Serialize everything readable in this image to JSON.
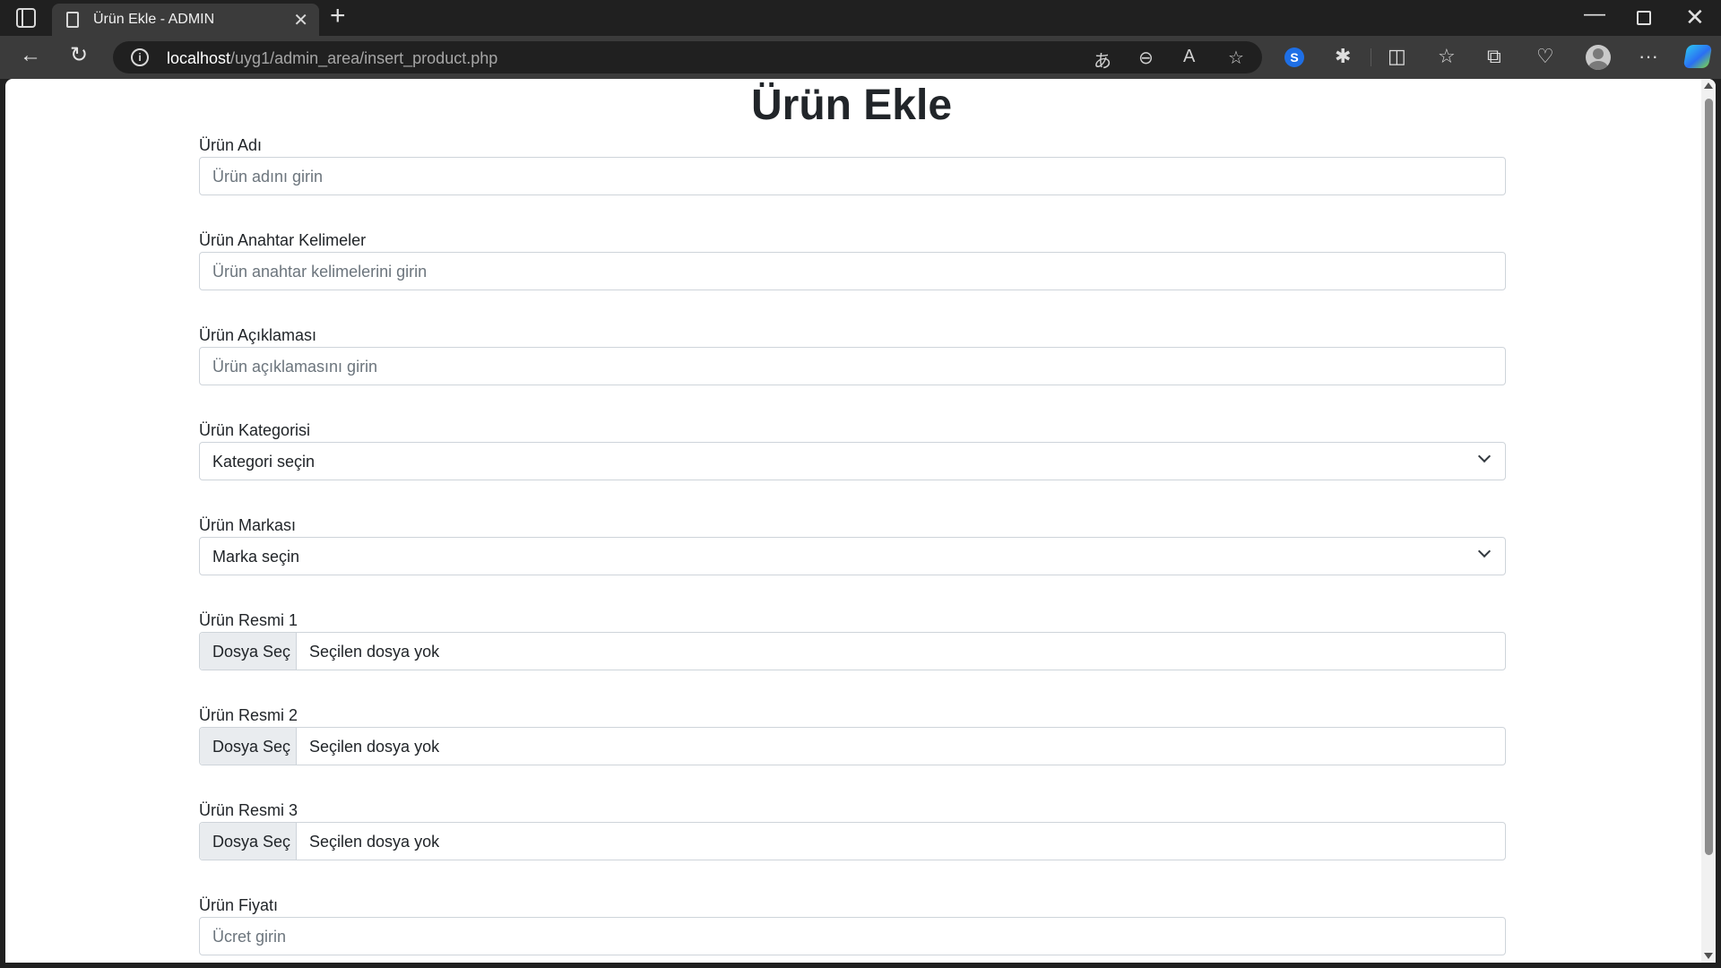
{
  "browser": {
    "tab_title": "Ürün Ekle - ADMIN",
    "url_host": "localhost",
    "url_path": "/uyg1/admin_area/insert_product.php"
  },
  "page": {
    "title": "Ürün Ekle"
  },
  "form": {
    "product_name": {
      "label": "Ürün Adı",
      "placeholder": "Ürün adını girin"
    },
    "product_keywords": {
      "label": "Ürün Anahtar Kelimeler",
      "placeholder": "Ürün anahtar kelimelerini girin"
    },
    "product_description": {
      "label": "Ürün Açıklaması",
      "placeholder": "Ürün açıklamasını girin"
    },
    "product_category": {
      "label": "Ürün Kategorisi",
      "selected": "Kategori seçin"
    },
    "product_brand": {
      "label": "Ürün Markası",
      "selected": "Marka seçin"
    },
    "product_image_1": {
      "label": "Ürün Resmi 1",
      "button": "Dosya Seç",
      "status": "Seçilen dosya yok"
    },
    "product_image_2": {
      "label": "Ürün Resmi 2",
      "button": "Dosya Seç",
      "status": "Seçilen dosya yok"
    },
    "product_image_3": {
      "label": "Ürün Resmi 3",
      "button": "Dosya Seç",
      "status": "Seçilen dosya yok"
    },
    "product_price": {
      "label": "Ürün Fiyatı",
      "placeholder": "Ücret girin"
    }
  }
}
